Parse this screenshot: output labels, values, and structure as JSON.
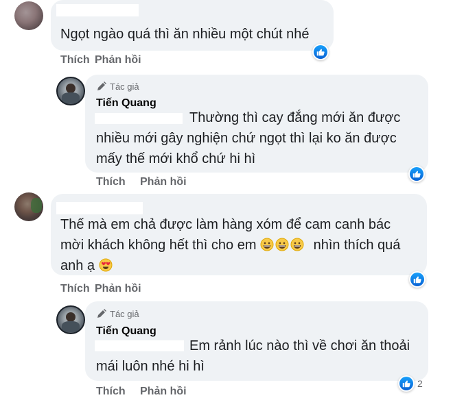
{
  "comments": [
    {
      "text": "Ngọt ngào quá thì ăn nhiều một chút nhé",
      "actions": {
        "like": "Thích",
        "reply": "Phản hồi"
      }
    },
    {
      "badge": "Tác giả",
      "author": "Tiến Quang",
      "line1": "Thường thì cay đắng mới ăn được",
      "line2": "nhiều mới gây nghiện chứ ngọt thì lại ko ăn được",
      "line3": "mấy thế mới khổ chứ hi hì",
      "actions": {
        "like": "Thích",
        "reply": "Phản hồi"
      }
    },
    {
      "line1": "Thế mà em chả được làm hàng xóm để cam canh bác",
      "line2a": "mời khách không hết thì cho em",
      "line2b": "nhìn thích quá",
      "line3": "anh ạ",
      "actions": {
        "like": "Thích",
        "reply": "Phản hồi"
      }
    },
    {
      "badge": "Tác giả",
      "author": "Tiến Quang",
      "line1": "Em rảnh lúc nào thì về chơi ăn thoải",
      "line2": "mái luôn nhé hi hì",
      "reaction_count": "2",
      "actions": {
        "like": "Thích",
        "reply": "Phản hồi"
      }
    }
  ],
  "colors": {
    "bubble": "#eff2f5",
    "like_blue": "#1877f2",
    "muted": "#65676b"
  },
  "icons": [
    "thumbs-up-icon",
    "pencil-icon",
    "grinning-emoji",
    "heart-eyes-emoji"
  ]
}
